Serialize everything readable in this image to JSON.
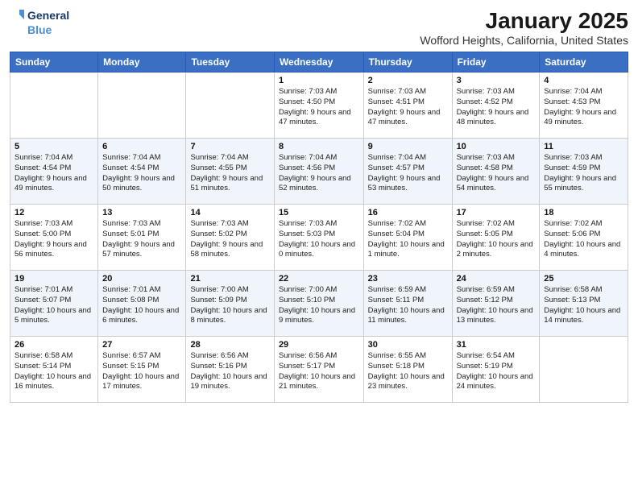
{
  "header": {
    "logo_line1": "General",
    "logo_line2": "Blue",
    "month": "January 2025",
    "location": "Wofford Heights, California, United States"
  },
  "days_of_week": [
    "Sunday",
    "Monday",
    "Tuesday",
    "Wednesday",
    "Thursday",
    "Friday",
    "Saturday"
  ],
  "weeks": [
    [
      {
        "num": "",
        "info": ""
      },
      {
        "num": "",
        "info": ""
      },
      {
        "num": "",
        "info": ""
      },
      {
        "num": "1",
        "info": "Sunrise: 7:03 AM\nSunset: 4:50 PM\nDaylight: 9 hours and 47 minutes."
      },
      {
        "num": "2",
        "info": "Sunrise: 7:03 AM\nSunset: 4:51 PM\nDaylight: 9 hours and 47 minutes."
      },
      {
        "num": "3",
        "info": "Sunrise: 7:03 AM\nSunset: 4:52 PM\nDaylight: 9 hours and 48 minutes."
      },
      {
        "num": "4",
        "info": "Sunrise: 7:04 AM\nSunset: 4:53 PM\nDaylight: 9 hours and 49 minutes."
      }
    ],
    [
      {
        "num": "5",
        "info": "Sunrise: 7:04 AM\nSunset: 4:54 PM\nDaylight: 9 hours and 49 minutes."
      },
      {
        "num": "6",
        "info": "Sunrise: 7:04 AM\nSunset: 4:54 PM\nDaylight: 9 hours and 50 minutes."
      },
      {
        "num": "7",
        "info": "Sunrise: 7:04 AM\nSunset: 4:55 PM\nDaylight: 9 hours and 51 minutes."
      },
      {
        "num": "8",
        "info": "Sunrise: 7:04 AM\nSunset: 4:56 PM\nDaylight: 9 hours and 52 minutes."
      },
      {
        "num": "9",
        "info": "Sunrise: 7:04 AM\nSunset: 4:57 PM\nDaylight: 9 hours and 53 minutes."
      },
      {
        "num": "10",
        "info": "Sunrise: 7:03 AM\nSunset: 4:58 PM\nDaylight: 9 hours and 54 minutes."
      },
      {
        "num": "11",
        "info": "Sunrise: 7:03 AM\nSunset: 4:59 PM\nDaylight: 9 hours and 55 minutes."
      }
    ],
    [
      {
        "num": "12",
        "info": "Sunrise: 7:03 AM\nSunset: 5:00 PM\nDaylight: 9 hours and 56 minutes."
      },
      {
        "num": "13",
        "info": "Sunrise: 7:03 AM\nSunset: 5:01 PM\nDaylight: 9 hours and 57 minutes."
      },
      {
        "num": "14",
        "info": "Sunrise: 7:03 AM\nSunset: 5:02 PM\nDaylight: 9 hours and 58 minutes."
      },
      {
        "num": "15",
        "info": "Sunrise: 7:03 AM\nSunset: 5:03 PM\nDaylight: 10 hours and 0 minutes."
      },
      {
        "num": "16",
        "info": "Sunrise: 7:02 AM\nSunset: 5:04 PM\nDaylight: 10 hours and 1 minute."
      },
      {
        "num": "17",
        "info": "Sunrise: 7:02 AM\nSunset: 5:05 PM\nDaylight: 10 hours and 2 minutes."
      },
      {
        "num": "18",
        "info": "Sunrise: 7:02 AM\nSunset: 5:06 PM\nDaylight: 10 hours and 4 minutes."
      }
    ],
    [
      {
        "num": "19",
        "info": "Sunrise: 7:01 AM\nSunset: 5:07 PM\nDaylight: 10 hours and 5 minutes."
      },
      {
        "num": "20",
        "info": "Sunrise: 7:01 AM\nSunset: 5:08 PM\nDaylight: 10 hours and 6 minutes."
      },
      {
        "num": "21",
        "info": "Sunrise: 7:00 AM\nSunset: 5:09 PM\nDaylight: 10 hours and 8 minutes."
      },
      {
        "num": "22",
        "info": "Sunrise: 7:00 AM\nSunset: 5:10 PM\nDaylight: 10 hours and 9 minutes."
      },
      {
        "num": "23",
        "info": "Sunrise: 6:59 AM\nSunset: 5:11 PM\nDaylight: 10 hours and 11 minutes."
      },
      {
        "num": "24",
        "info": "Sunrise: 6:59 AM\nSunset: 5:12 PM\nDaylight: 10 hours and 13 minutes."
      },
      {
        "num": "25",
        "info": "Sunrise: 6:58 AM\nSunset: 5:13 PM\nDaylight: 10 hours and 14 minutes."
      }
    ],
    [
      {
        "num": "26",
        "info": "Sunrise: 6:58 AM\nSunset: 5:14 PM\nDaylight: 10 hours and 16 minutes."
      },
      {
        "num": "27",
        "info": "Sunrise: 6:57 AM\nSunset: 5:15 PM\nDaylight: 10 hours and 17 minutes."
      },
      {
        "num": "28",
        "info": "Sunrise: 6:56 AM\nSunset: 5:16 PM\nDaylight: 10 hours and 19 minutes."
      },
      {
        "num": "29",
        "info": "Sunrise: 6:56 AM\nSunset: 5:17 PM\nDaylight: 10 hours and 21 minutes."
      },
      {
        "num": "30",
        "info": "Sunrise: 6:55 AM\nSunset: 5:18 PM\nDaylight: 10 hours and 23 minutes."
      },
      {
        "num": "31",
        "info": "Sunrise: 6:54 AM\nSunset: 5:19 PM\nDaylight: 10 hours and 24 minutes."
      },
      {
        "num": "",
        "info": ""
      }
    ]
  ]
}
